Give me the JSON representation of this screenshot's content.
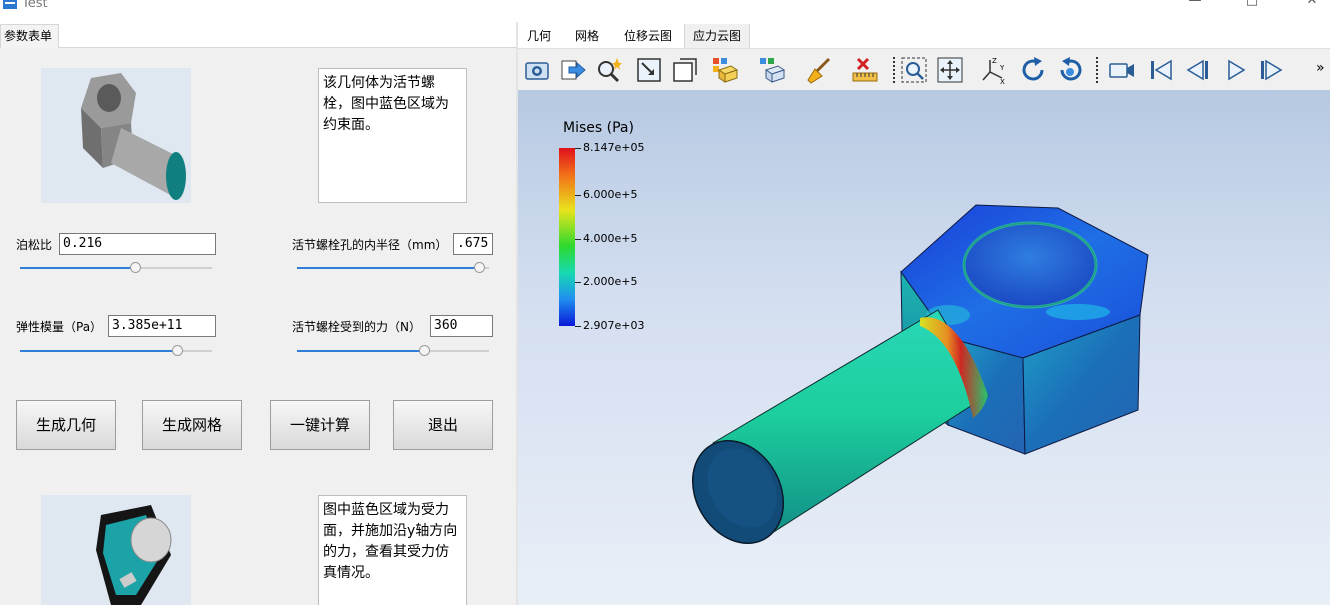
{
  "window": {
    "title": "Test"
  },
  "left_panel": {
    "tab_label": "参数表单",
    "note_top": "该几何体为活节螺栓，图中蓝色区域为约束面。",
    "note_bottom": "图中蓝色区域为受力面，并施加沿y轴方向的力，查看其受力仿真情况。",
    "fields": {
      "poisson": {
        "label": "泊松比",
        "value": "0.216",
        "slider_fraction": 0.6
      },
      "modulus": {
        "label": "弹性模量（Pa）",
        "value": "3.385e+11",
        "slider_fraction": 0.82
      },
      "inner_radius": {
        "label": "活节螺栓孔的内半径（mm）",
        "value": ".675",
        "slider_fraction": 0.95
      },
      "force": {
        "label": "活节螺栓受到的力（N）",
        "value": "360",
        "slider_fraction": 0.66
      }
    },
    "buttons": {
      "gen_geometry": "生成几何",
      "gen_mesh": "生成网格",
      "compute": "一键计算",
      "exit": "退出"
    }
  },
  "right_panel": {
    "tabs": [
      "几何",
      "网格",
      "位移云图",
      "应力云图"
    ],
    "active_tab": "应力云图",
    "overflow_label": "»",
    "legend": {
      "title": "Mises (Pa)",
      "labels": [
        "8.147e+05",
        "6.000e+5",
        "4.000e+5",
        "2.000e+5",
        "2.907e+03"
      ]
    }
  },
  "icons": [
    "camera-icon",
    "export-icon",
    "zoom-sparkle-icon",
    "fit-view-icon",
    "box-view-icon",
    "surface-style-icon",
    "edge-style-icon",
    "broom-clear-icon",
    "ruler-delete-icon",
    "zoom-box-icon",
    "pan-icon",
    "axes-icon",
    "rotate-cw-icon",
    "rotate-ccw-icon",
    "video-camera-icon",
    "first-frame-icon",
    "prev-frame-icon",
    "play-icon",
    "next-frame-icon"
  ]
}
